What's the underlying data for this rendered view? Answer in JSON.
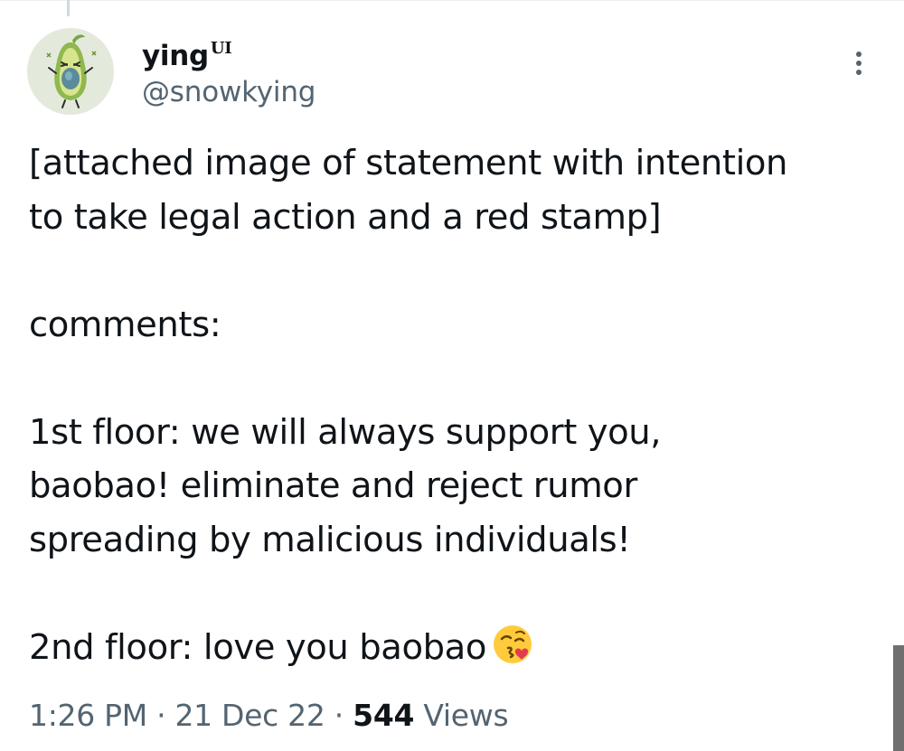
{
  "user": {
    "display_name": "ying",
    "name_badge": "UI",
    "handle": "@snowkying",
    "avatar": "avocado-avatar"
  },
  "more_icon": "more-vertical-icon",
  "tweet": {
    "paragraphs": [
      "[attached image of statement with intention\nto take legal action and a red stamp]",
      "comments:",
      "1st floor: we will always support you,\nbaobao! eliminate and reject rumor\nspreading by malicious individuals!",
      "2nd floor: love you baobao"
    ],
    "emoji": "face-blowing-kiss-emoji"
  },
  "meta": {
    "time": "1:26 PM",
    "separator": " · ",
    "date": "21 Dec 22",
    "views_count": "544",
    "views_label": "Views"
  },
  "colors": {
    "text_primary": "#0f1419",
    "text_secondary": "#536471",
    "background": "#ffffff"
  }
}
